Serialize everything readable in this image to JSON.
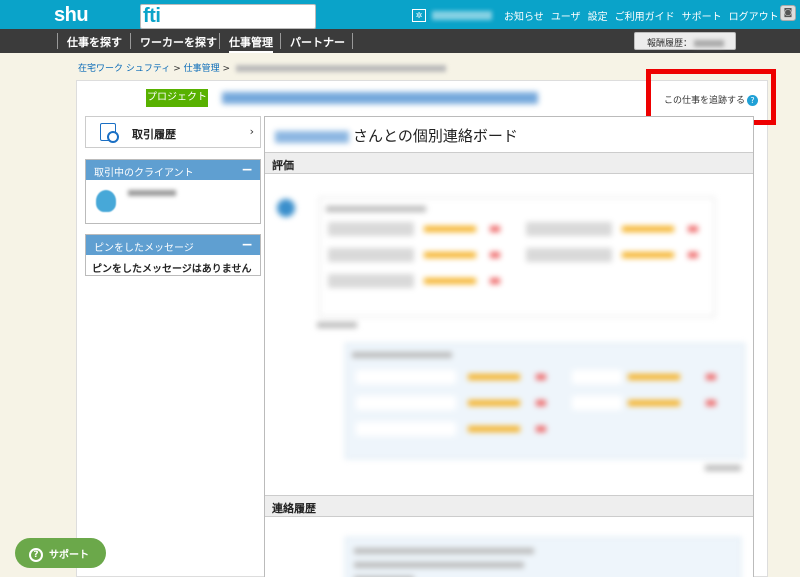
{
  "brand": {
    "logo_text": "shu",
    "logo_box": "fti"
  },
  "header": {
    "links": [
      "お知らせ",
      "ユーザ",
      "設定",
      "ご利用ガイド",
      "サポート",
      "ログアウト"
    ]
  },
  "nav": {
    "items": [
      "仕事を探す",
      "ワーカーを探す",
      "仕事管理",
      "パートナー"
    ],
    "reward_label": "報酬履歴："
  },
  "breadcrumb": {
    "home": "在宅ワーク シュフティ",
    "sep": ">",
    "mgmt": "仕事管理"
  },
  "project": {
    "badge": "プロジェクト",
    "follow_label": "この仕事を追跡する",
    "help_glyph": "?"
  },
  "sidebar": {
    "history_label": "取引履歴",
    "chevron": "›",
    "clients_heading": "取引中のクライアント",
    "pinned_heading": "ピンをしたメッセージ",
    "pinned_empty": "ピンをしたメッセージはありません",
    "collapse_glyph": "−"
  },
  "board": {
    "title_suffix": "さんとの個別連絡ボード",
    "eval_heading": "評価",
    "contact_heading": "連絡履歴"
  },
  "support": {
    "label": "サポート",
    "glyph": "?"
  },
  "colors": {
    "header_bg": "#0aa3c9",
    "nav_bg": "#3b3b3b",
    "badge_green": "#58b100",
    "box_head": "#5f9fd1",
    "highlight_red": "#ee0000",
    "support_green": "#6ba84a"
  }
}
